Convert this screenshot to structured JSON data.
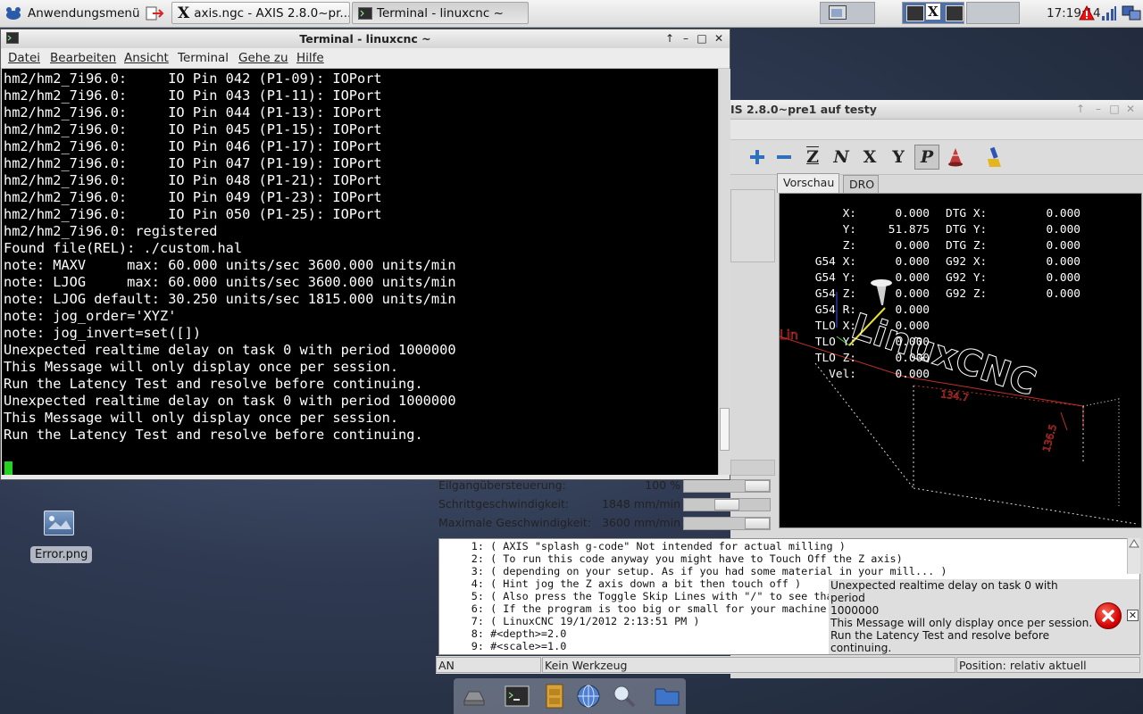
{
  "panel": {
    "app_menu_label": "Anwendungsmenü",
    "tasks": [
      {
        "label": "axis.ngc - AXIS 2.8.0~pr..."
      },
      {
        "label": "Terminal - linuxcnc  ~"
      }
    ],
    "clock": "17:19:14"
  },
  "terminal": {
    "title": "Terminal - linuxcnc  ~",
    "menu": [
      "Datei",
      "Bearbeiten",
      "Ansicht",
      "Terminal",
      "Gehe zu",
      "Hilfe"
    ],
    "lines": [
      "hm2/hm2_7i96.0:     IO Pin 042 (P1-09): IOPort",
      "hm2/hm2_7i96.0:     IO Pin 043 (P1-11): IOPort",
      "hm2/hm2_7i96.0:     IO Pin 044 (P1-13): IOPort",
      "hm2/hm2_7i96.0:     IO Pin 045 (P1-15): IOPort",
      "hm2/hm2_7i96.0:     IO Pin 046 (P1-17): IOPort",
      "hm2/hm2_7i96.0:     IO Pin 047 (P1-19): IOPort",
      "hm2/hm2_7i96.0:     IO Pin 048 (P1-21): IOPort",
      "hm2/hm2_7i96.0:     IO Pin 049 (P1-23): IOPort",
      "hm2/hm2_7i96.0:     IO Pin 050 (P1-25): IOPort",
      "hm2/hm2_7i96.0: registered",
      "Found file(REL): ./custom.hal",
      "note: MAXV     max: 60.000 units/sec 3600.000 units/min",
      "note: LJOG     max: 60.000 units/sec 3600.000 units/min",
      "note: LJOG default: 30.250 units/sec 1815.000 units/min",
      "note: jog_order='XYZ'",
      "note: jog_invert=set([])",
      "Unexpected realtime delay on task 0 with period 1000000",
      "This Message will only display once per session.",
      "Run the Latency Test and resolve before continuing.",
      "Unexpected realtime delay on task 0 with period 1000000",
      "This Message will only display once per session.",
      "Run the Latency Test and resolve before continuing."
    ]
  },
  "axis": {
    "title": "IS 2.8.0~pre1 auf  testy",
    "tabs": [
      "Vorschau",
      "DRO"
    ],
    "toolbar": [
      "plus-icon",
      "minus-icon",
      "Z",
      "N",
      "X",
      "Y",
      "P",
      "rotate-view-icon",
      "clear-plot-icon"
    ],
    "dro_left": [
      {
        "label": "X:",
        "value": "0.000"
      },
      {
        "label": "Y:",
        "value": "51.875"
      },
      {
        "label": "Z:",
        "value": "0.000"
      },
      {
        "label": "G54 X:",
        "value": "0.000"
      },
      {
        "label": "G54 Y:",
        "value": "0.000"
      },
      {
        "label": "G54 Z:",
        "value": "0.000"
      },
      {
        "label": "G54 R:",
        "value": "0.000"
      },
      {
        "label": "TLO X:",
        "value": "0.000"
      },
      {
        "label": "TLO Y:",
        "value": "0.000"
      },
      {
        "label": "TLO Z:",
        "value": "0.000"
      },
      {
        "label": "Vel:",
        "value": "0.000"
      }
    ],
    "dro_right": [
      {
        "label": "DTG X:",
        "value": "0.000"
      },
      {
        "label": "DTG Y:",
        "value": "0.000"
      },
      {
        "label": "DTG Z:",
        "value": "0.000"
      },
      {
        "label": "G92 X:",
        "value": "0.000"
      },
      {
        "label": "G92 Y:",
        "value": "0.000"
      },
      {
        "label": "G92 Z:",
        "value": "0.000"
      }
    ],
    "preview_dims": [
      "134.7",
      "136.5"
    ],
    "preview_text": "LinuxCNC",
    "overrides": [
      {
        "label": "Eilgangübersteuerung:",
        "value": "100 %",
        "level": 1.0
      },
      {
        "label": "Schrittgeschwindigkeit:",
        "value": "1848 mm/min",
        "level": 0.5
      },
      {
        "label": "Maximale Geschwindigkeit:",
        "value": "3600 mm/min",
        "level": 1.0
      }
    ],
    "gcode": [
      {
        "n": "1:",
        "t": "( AXIS \"splash g-code\" Not intended for actual milling )"
      },
      {
        "n": "2:",
        "t": "( To run this code anyway you might have to Touch Off the Z axis)"
      },
      {
        "n": "3:",
        "t": "( depending on your setup. As if you had some material in your mill... )"
      },
      {
        "n": "4:",
        "t": "( Hint jog the Z axis down a bit then touch off )"
      },
      {
        "n": "5:",
        "t": "( Also press the Toggle Skip Lines with \"/\" to see tha"
      },
      {
        "n": "6:",
        "t": "( If the program is too big or small for your machine,"
      },
      {
        "n": "7:",
        "t": "( LinuxCNC 19/1/2012 2:13:51 PM )"
      },
      {
        "n": "8:",
        "t": "#<depth>=2.0"
      },
      {
        "n": "9:",
        "t": "#<scale>=1.0"
      }
    ],
    "message": {
      "l1": "Unexpected realtime delay on task 0 with period",
      "l2": "1000000",
      "l3": "This Message will only display once per session.",
      "l4": "Run the Latency Test and resolve before",
      "l5": "continuing."
    },
    "status": {
      "state": "AN",
      "tool": "Kein Werkzeug",
      "position": "Position: relativ aktuell"
    }
  },
  "desktop": {
    "icon_label": "Error.png"
  },
  "dock": [
    "storage-icon",
    "terminal-icon",
    "file-cabinet-icon",
    "web-browser-icon",
    "search-icon",
    "folder-icon"
  ]
}
